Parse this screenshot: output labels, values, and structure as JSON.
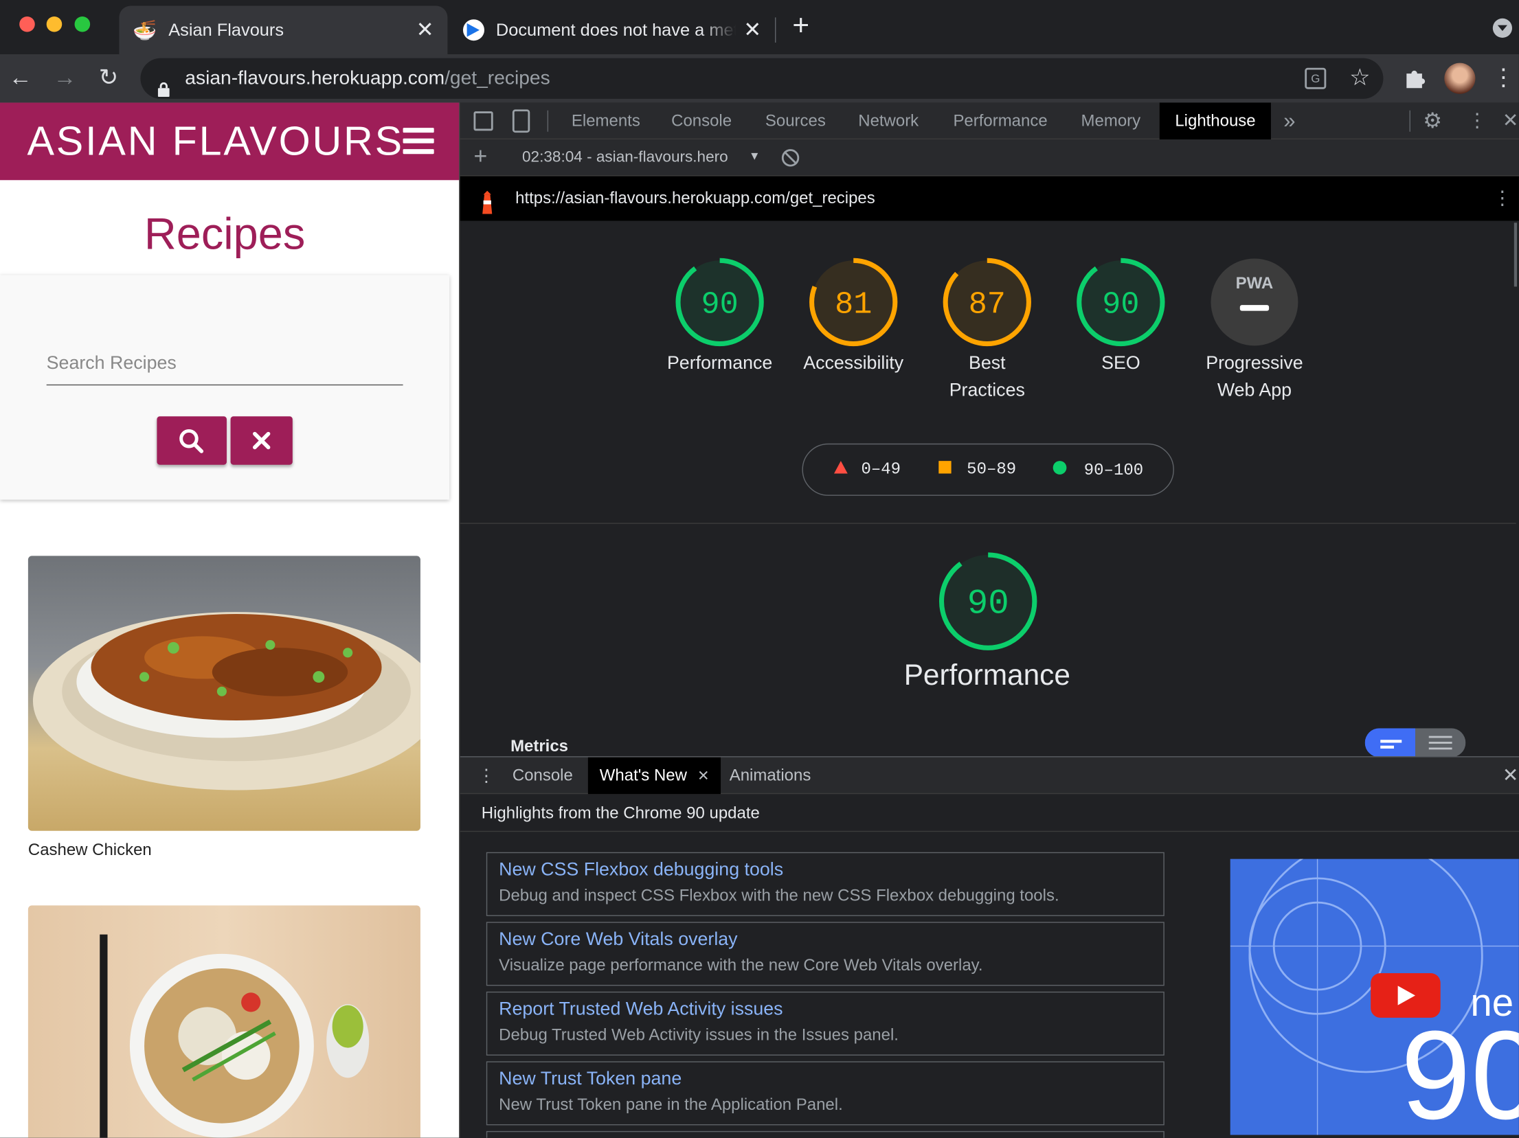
{
  "browser": {
    "tabs": [
      {
        "title": "Asian Flavours"
      },
      {
        "title": "Document does not have a meta description"
      }
    ],
    "url_host": "asian-flavours.herokuapp.com",
    "url_path": "/get_recipes"
  },
  "site": {
    "brand": "ASIAN FLAVOURS",
    "heading": "Recipes",
    "search_placeholder": "Search Recipes",
    "recipes": [
      {
        "name": "Cashew Chicken"
      }
    ]
  },
  "devtools": {
    "tabs": [
      "Elements",
      "Console",
      "Sources",
      "Network",
      "Performance",
      "Memory",
      "Lighthouse"
    ],
    "selected_tab": "Lighthouse",
    "report_selector": "02:38:04 - asian-flavours.hero",
    "report_url": "https://asian-flavours.herokuapp.com/get_recipes",
    "scores": [
      {
        "label": "Performance",
        "score": 90,
        "color": "#0cce6b"
      },
      {
        "label": "Accessibility",
        "score": 81,
        "color": "#ffa400"
      },
      {
        "label": "Best Practices",
        "score": 87,
        "color": "#ffa400"
      },
      {
        "label": "SEO",
        "score": 90,
        "color": "#0cce6b"
      }
    ],
    "pwa": {
      "badge": "PWA",
      "label": "Progressive Web App"
    },
    "legend": {
      "fail": "0–49",
      "average": "50–89",
      "pass": "90–100",
      "colors": {
        "fail": "#ff4e42",
        "average": "#ffa400",
        "pass": "#0cce6b"
      }
    },
    "featured": {
      "label": "Performance",
      "score": 90
    },
    "metrics_heading": "Metrics",
    "drawer": {
      "tabs": [
        "Console",
        "What's New",
        "Animations"
      ],
      "selected_tab": "What's New",
      "highlights": "Highlights from the Chrome 90 update",
      "items": [
        {
          "title": "New CSS Flexbox debugging tools",
          "desc": "Debug and inspect CSS Flexbox with the new CSS Flexbox debugging tools."
        },
        {
          "title": "New Core Web Vitals overlay",
          "desc": "Visualize page performance with the new Core Web Vitals overlay."
        },
        {
          "title": "Report Trusted Web Activity issues",
          "desc": "Debug Trusted Web Activity issues in the Issues panel."
        },
        {
          "title": "New Trust Token pane",
          "desc": "New Trust Token pane in the Application Panel."
        }
      ],
      "video_text_1": "ne",
      "video_text_2": "90"
    }
  }
}
